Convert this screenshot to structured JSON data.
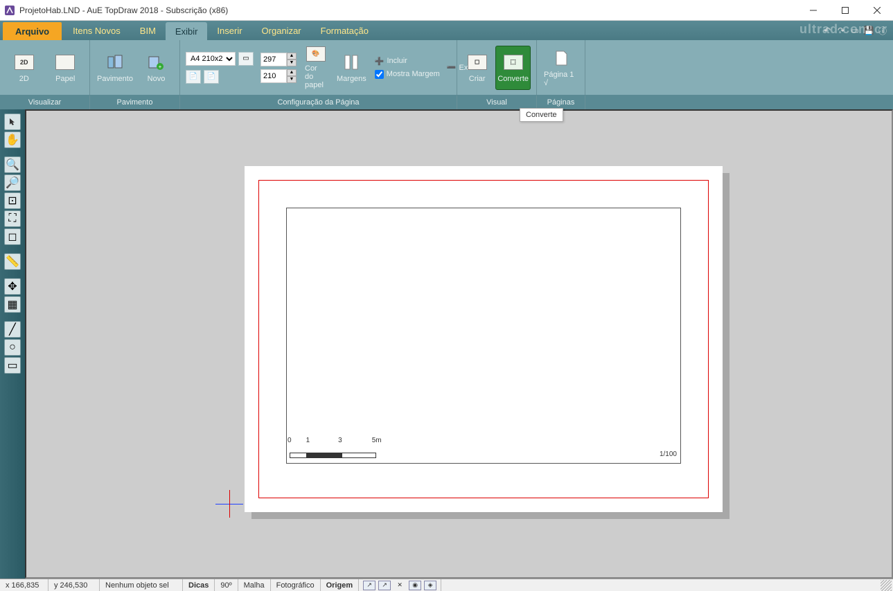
{
  "title": "ProjetoHab.LND - AuE TopDraw 2018  - Subscrição (x86)",
  "watermark": "ultrad.com.cr",
  "tabs": {
    "file": "Arquivo",
    "itens": "Itens Novos",
    "bim": "BIM",
    "exibir": "Exibir",
    "inserir": "Inserir",
    "organizar": "Organizar",
    "formatacao": "Formatação"
  },
  "ribbon": {
    "visualizar": {
      "label": "Visualizar",
      "btn_2d": "2D",
      "btn_papel": "Papel"
    },
    "pavimento": {
      "label": "Pavimento",
      "btn_pav": "Pavimento",
      "btn_novo": "Novo"
    },
    "config": {
      "label": "Configuração da Página",
      "paper_select": "A4 210x2",
      "width": "297",
      "height": "210",
      "cor": "Cor do papel",
      "margens": "Margens",
      "incluir": "Incluir",
      "excluir": "Excluir",
      "mostra": "Mostra Margem"
    },
    "visual": {
      "label": "Visual",
      "criar": "Criar",
      "converte": "Converte"
    },
    "paginas": {
      "label": "Páginas",
      "pagina1": "Página 1 √"
    }
  },
  "tooltip": "Converte",
  "canvas": {
    "scale_marks": [
      "0",
      "1",
      "3",
      "5m"
    ],
    "page_scale": "1/100"
  },
  "status": {
    "x": "x 166,835",
    "y": "y 246,530",
    "sel": "Nenhum objeto sel",
    "dicas": "Dicas",
    "ang": "90º",
    "malha": "Malha",
    "foto": "Fotográfico",
    "origem": "Origem"
  }
}
